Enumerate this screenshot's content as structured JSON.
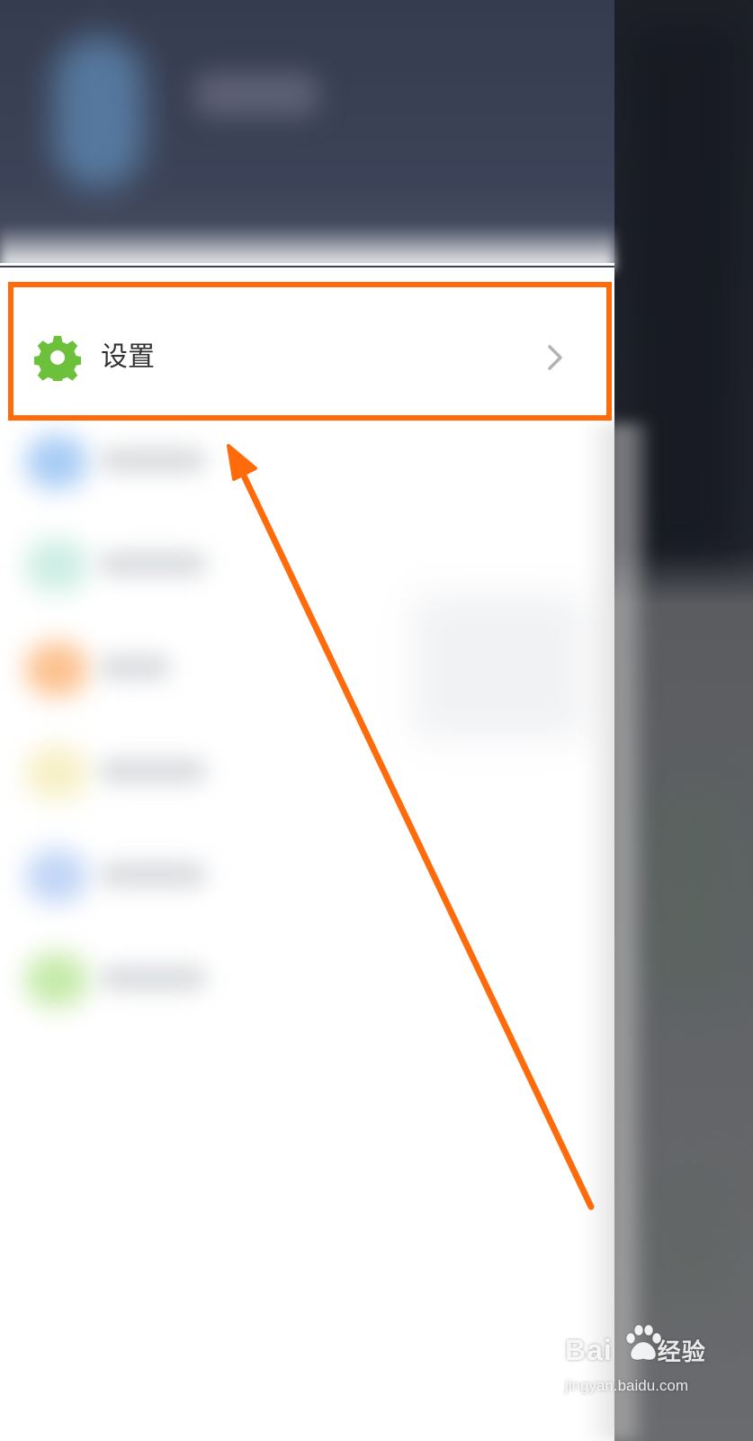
{
  "menu": {
    "settings": {
      "label": "设置",
      "icon": "gear-icon",
      "icon_color": "#6dc03a",
      "trailing_icon": "chevron-right-icon"
    }
  },
  "annotation": {
    "color": "#ff6a0b",
    "highlight_target": "settings"
  },
  "watermark": {
    "brand": "Bai",
    "brand_suffix": "经验",
    "url": "jingyan.baidu.com"
  }
}
